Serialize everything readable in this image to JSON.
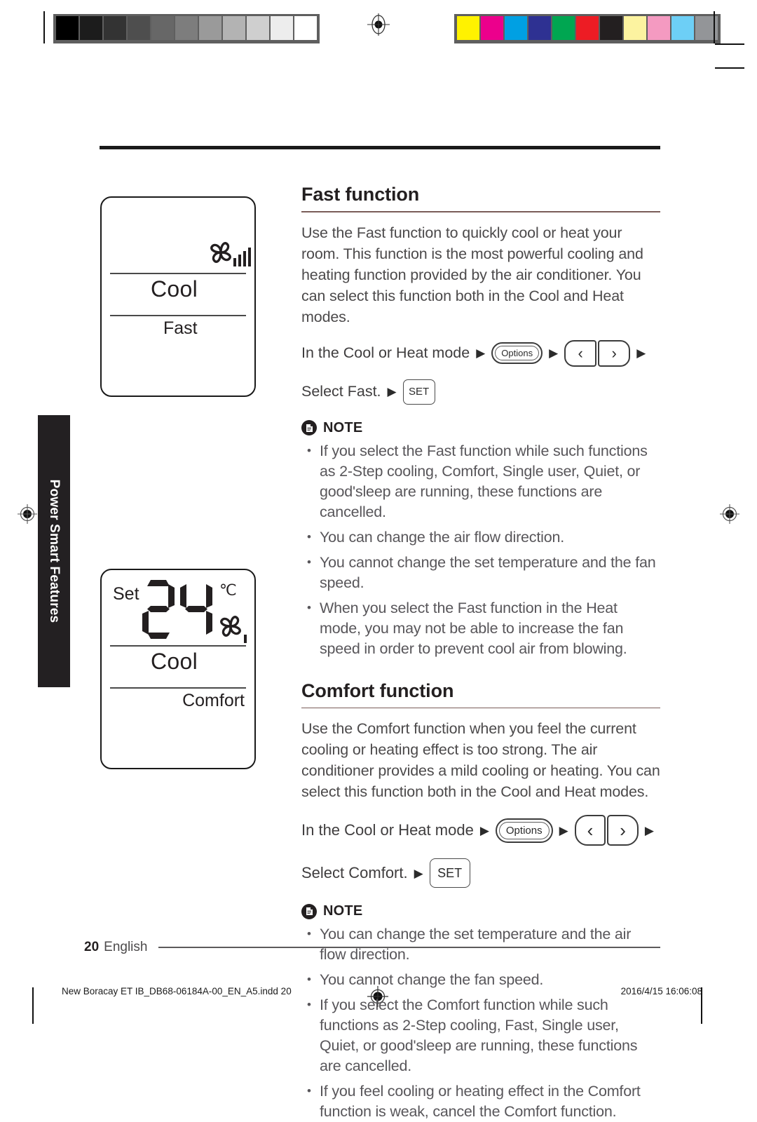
{
  "prepress": {
    "gray_swatches": [
      "#000000",
      "#1c1c1c",
      "#333333",
      "#4e4e4e",
      "#676767",
      "#7d7d7d",
      "#9a9a9a",
      "#b3b3b3",
      "#cfcfcf",
      "#ededed",
      "#ffffff"
    ],
    "color_swatches": [
      "#fff200",
      "#ec008c",
      "#00a0e3",
      "#2e3192",
      "#00a651",
      "#ed1c24",
      "#231f20",
      "#fcf3a0",
      "#f49ac1",
      "#6dcff6",
      "#939598"
    ],
    "registration_mark": "registration-target-icon"
  },
  "sidebar": {
    "tab_label": "Power Smart Features"
  },
  "displays": [
    {
      "name": "fast-display",
      "set_word": "",
      "temperature": "",
      "unit": "",
      "mode_label": "Cool",
      "function_label": "Fast",
      "fan_icon": "fan-blade-icon",
      "fan_bars": 4
    },
    {
      "name": "comfort-display",
      "set_word": "Set",
      "temperature": "24",
      "unit": "℃",
      "mode_label": "Cool",
      "function_label": "Comfort",
      "fan_icon": "fan-blade-icon",
      "fan_bars": 1
    }
  ],
  "sections": [
    {
      "id": "fast",
      "title": "Fast function",
      "body": "Use the Fast function to quickly cool or heat your room. This function is the most powerful cooling and heating function provided by the air conditioner. You can select this function both in the Cool and Heat modes.",
      "step1_text": "In the Cool or Heat mode",
      "step2_text": "Select Fast.",
      "options_label": "Options",
      "left_arrow": "‹",
      "right_arrow": "›",
      "set_label": "SET",
      "triangle": "▶",
      "note_label": "NOTE",
      "note_icon": "document-note-icon",
      "notes": [
        "If you select the Fast function while such functions as 2-Step cooling, Comfort, Single user, Quiet, or good'sleep are running, these functions are cancelled.",
        "You can change the air flow direction.",
        "You cannot change the set temperature and the fan speed.",
        "When you select the Fast function in the Heat mode, you may not be able to increase the fan speed in order to prevent cool air from blowing."
      ]
    },
    {
      "id": "comfort",
      "title": "Comfort function",
      "body": "Use the Comfort function when you feel the current cooling or heating effect is too strong. The air conditioner provides a mild cooling or heating. You can select this function both in the Cool and Heat modes.",
      "step1_text": "In the Cool or Heat mode",
      "step2_text": "Select Comfort.",
      "options_label": "Options",
      "left_arrow": "‹",
      "right_arrow": "›",
      "set_label": "SET",
      "triangle": "▶",
      "note_label": "NOTE",
      "note_icon": "document-note-icon",
      "notes": [
        "You can change the set temperature and the air flow direction.",
        "You cannot change the fan speed.",
        "If you select the Comfort function while such functions as 2-Step cooling, Fast, Single user, Quiet, or good'sleep are running, these functions are cancelled.",
        "If you feel cooling or heating effect in the Comfort function is weak, cancel the Comfort function."
      ]
    }
  ],
  "footer": {
    "page_number": "20",
    "language": "English",
    "imprint_file": "New Boracay ET IB_DB68-06184A-00_EN_A5.indd   20",
    "imprint_timestamp": "2016/4/15   16:06:08"
  },
  "colors": {
    "title_rule": "#7a5c58",
    "tab_background": "#232022",
    "ink": "#231f20"
  }
}
